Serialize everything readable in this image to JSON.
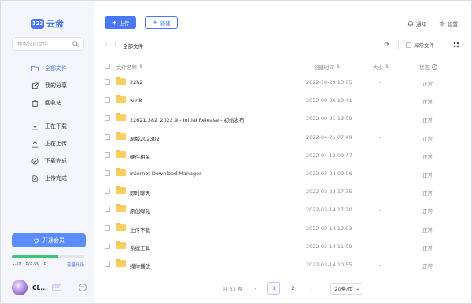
{
  "app": {
    "logo_badge": "123",
    "logo_text": "云盘"
  },
  "search": {
    "placeholder": "搜索您的文件"
  },
  "sidebar": {
    "items": [
      {
        "label": "全部文件",
        "icon": "folder-icon",
        "active": true
      },
      {
        "label": "我的分享",
        "icon": "share-icon"
      },
      {
        "label": "回收站",
        "icon": "trash-icon"
      },
      {
        "label": "正在下载",
        "icon": "download-icon"
      },
      {
        "label": "正在上传",
        "icon": "upload-icon"
      },
      {
        "label": "下载完成",
        "icon": "check-circle-icon"
      },
      {
        "label": "上传完成",
        "icon": "file-done-icon"
      }
    ],
    "vip_label": "开通会员",
    "storage_text": "1.29 TB/2.00 TB",
    "storage_fraction": 0.645,
    "upgrade_label": "容量升级",
    "user_name": "CL...",
    "vip_tag": "VIP"
  },
  "toolbar": {
    "upload_label": "上传",
    "new_label": "新建",
    "notify_label": "通知",
    "settings_label": "设置"
  },
  "breadcrumb": {
    "current": "全部文件",
    "abnormal_label": "异常文件"
  },
  "table": {
    "headers": {
      "name": "文件名称",
      "time": "创建时间",
      "size": "大小",
      "state": "状态"
    },
    "rows": [
      {
        "name": "22h2",
        "time": "2022-10-29 13:05",
        "size": "-",
        "state": "正常"
      },
      {
        "name": "win8",
        "time": "2022-09-26 19:41",
        "size": "-",
        "state": "正常"
      },
      {
        "name": "22621.382_2022.9 - Initial Release - 初始发布",
        "time": "2022-09-21 13:09",
        "size": "-",
        "state": "正常"
      },
      {
        "name": "原版202302",
        "time": "2022-04-21 07:49",
        "size": "-",
        "state": "正常"
      },
      {
        "name": "硬件相关",
        "time": "2022-04-12 09:47",
        "size": "-",
        "state": "正常"
      },
      {
        "name": "Internet Download Manager",
        "time": "2022-03-24 09:06",
        "size": "-",
        "state": "正常"
      },
      {
        "name": "即时聊天",
        "time": "2022-03-23 17:35",
        "size": "-",
        "state": "正常"
      },
      {
        "name": "原创绿化",
        "time": "2022-03-14 17:20",
        "size": "-",
        "state": "正常"
      },
      {
        "name": "上传下载",
        "time": "2022-03-14 12:03",
        "size": "-",
        "state": "正常"
      },
      {
        "name": "系统工具",
        "time": "2022-03-14 11:09",
        "size": "-",
        "state": "正常"
      },
      {
        "name": "媒体播放",
        "time": "2022-03-14 10:55",
        "size": "-",
        "state": "正常"
      }
    ]
  },
  "pager": {
    "total": "共 33 条",
    "page1": "1",
    "page2": "2",
    "per_page": "20条/页"
  },
  "colors": {
    "accent": "#4a78f5",
    "folder": "#f6c34f",
    "storage": "#3fc47a"
  }
}
